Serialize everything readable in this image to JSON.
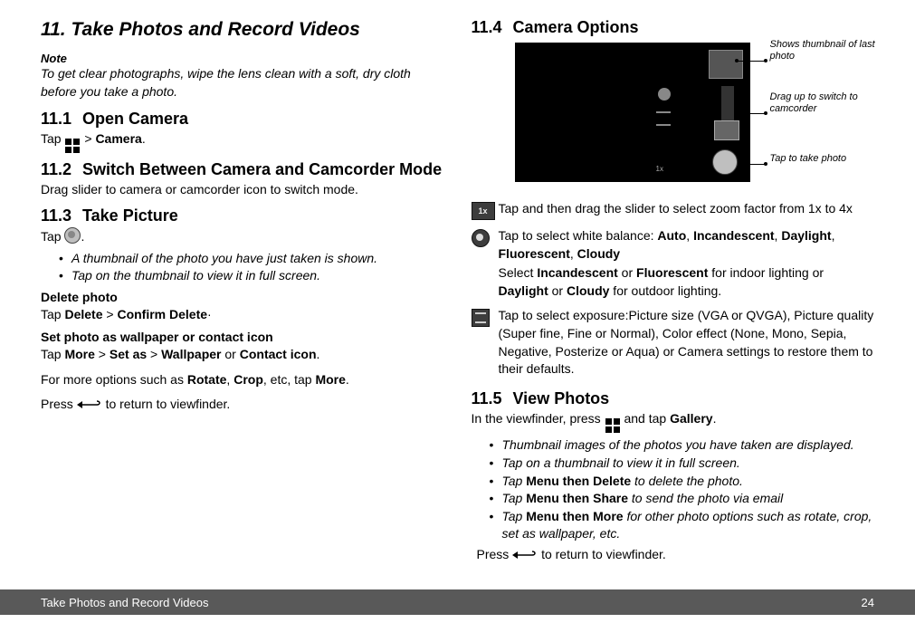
{
  "chapter": {
    "number": "11.",
    "title": "Take Photos and Record Videos"
  },
  "note": {
    "label": "Note",
    "body": "To get clear photographs, wipe the lens clean with a soft, dry cloth before you take a photo."
  },
  "sections": {
    "s11_1": {
      "num": "11.1",
      "title": "Open Camera",
      "line_pre": "Tap ",
      "line_mid": " > ",
      "bold1": "Camera",
      "line_post": "."
    },
    "s11_2": {
      "num": "11.2",
      "title": "Switch Between Camera and Camcorder Mode",
      "body": "Drag slider to camera or camcorder icon to switch mode."
    },
    "s11_3": {
      "num": "11.3",
      "title": "Take Picture",
      "tap_pre": "Tap ",
      "tap_post": ".",
      "bullets": [
        "A thumbnail of the photo you have just taken is shown.",
        "Tap on the thumbnail to view it in full screen."
      ],
      "delete_heading": "Delete photo",
      "delete_line_pre": "Tap ",
      "delete_b1": "Delete",
      "delete_mid": " > ",
      "delete_b2": "Confirm Delete",
      "delete_post": "·",
      "setas_heading": "Set photo as wallpaper or contact icon",
      "setas_pre": "Tap ",
      "setas_b1": "More",
      "setas_m1": " > ",
      "setas_b2": "Set as",
      "setas_m2": " > ",
      "setas_b3": "Wallpaper",
      "setas_or": " or ",
      "setas_b4": "Contact icon",
      "setas_post": ".",
      "more_pre": "For more options such as ",
      "more_b1": "Rotate",
      "more_m1": ", ",
      "more_b2": "Crop",
      "more_m2": ", etc, tap ",
      "more_b3": "More",
      "more_post": ".",
      "press_pre": "Press ",
      "press_post": " to return to viewfinder."
    },
    "s11_4": {
      "num": "11.4",
      "title": "Camera Options",
      "callouts": {
        "thumb": "Shows thumbnail of last photo",
        "drag": "Drag up to switch to camcorder",
        "tap": "Tap to take photo"
      },
      "zoom_icon_text": "1x",
      "rows": {
        "zoom": "Tap and then drag the slider to select zoom factor from 1x to 4x",
        "wb_pre": "Tap to select white balance: ",
        "wb_b1": "Auto",
        "wb_m1": ", ",
        "wb_b2": "Incandescent",
        "wb_m2": ", ",
        "wb_b3": "Daylight",
        "wb_m3": ", ",
        "wb_b4": "Fluorescent",
        "wb_m4": ", ",
        "wb_b5": "Cloudy",
        "wb_l2_pre": "Select ",
        "wb_l2_b1": "Incandescent",
        "wb_l2_m1": " or ",
        "wb_l2_b2": "Fluorescent",
        "wb_l2_m2": " for indoor lighting or ",
        "wb_l2_b3": "Daylight",
        "wb_l2_m3": " or ",
        "wb_l2_b4": "Cloudy",
        "wb_l2_post": " for outdoor lighting.",
        "settings": "Tap to select exposure:Picture size (VGA or QVGA), Picture quality (Super fine, Fine or Normal), Color effect (None, Mono, Sepia, Negative, Posterize or Aqua) or Camera settings to restore them to their defaults."
      }
    },
    "s11_5": {
      "num": "11.5",
      "title": "View Photos",
      "line_pre": "In the viewfinder, press ",
      "line_mid": " and tap ",
      "line_b1": "Gallery",
      "line_post": ".",
      "bullets": {
        "b1": "Thumbnail images of the photos you have taken are displayed.",
        "b2": "Tap on a thumbnail to view it in full screen.",
        "b3_pre": "Tap ",
        "b3_b": "Menu then Delete",
        "b3_post": " to delete the photo.",
        "b4_pre": "Tap ",
        "b4_b": "Menu then Share",
        "b4_post": " to send the photo via email",
        "b5_pre": "Tap ",
        "b5_b": "Menu then More",
        "b5_post": " for other photo options such as rotate, crop, set as wallpaper, etc."
      },
      "press_pre": "Press ",
      "press_post": " to return to viewfinder."
    }
  },
  "footer": {
    "left": "Take Photos and Record Videos",
    "right": "24"
  }
}
